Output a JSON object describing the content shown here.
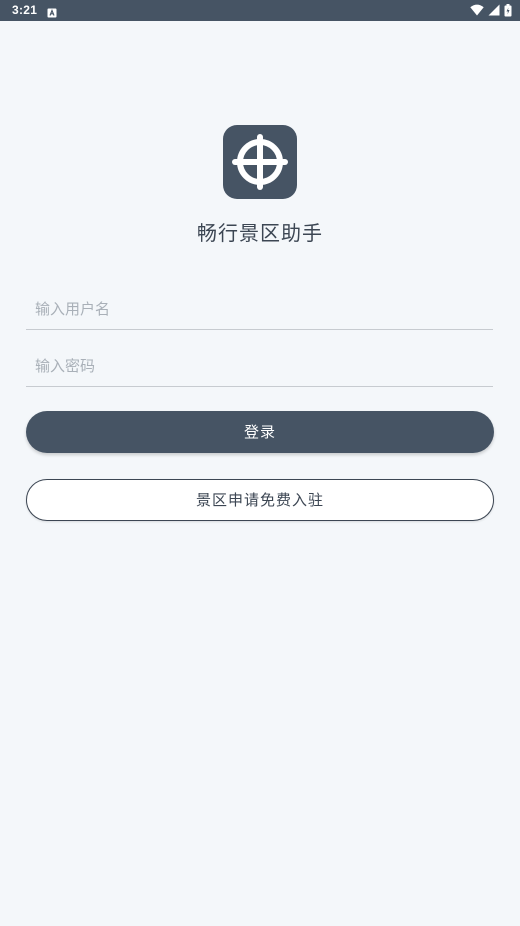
{
  "status_bar": {
    "time": "3:21",
    "notification_icon": "a-notification-icon",
    "wifi_icon": "wifi-icon",
    "signal_icon": "signal-icon",
    "battery_icon": "battery-icon"
  },
  "app": {
    "logo_icon": "grid-cross-logo-icon",
    "title": "畅行景区助手"
  },
  "login_form": {
    "username_placeholder": "输入用户名",
    "username_value": "",
    "password_placeholder": "输入密码",
    "password_value": "",
    "login_label": "登录",
    "apply_label": "景区申请免费入驻"
  },
  "colors": {
    "background": "#f4f7fa",
    "primary": "#465464",
    "status_bar": "#465464",
    "text_dark": "#3c4653",
    "placeholder": "#a9b0b8",
    "divider": "#c7cbd0"
  }
}
